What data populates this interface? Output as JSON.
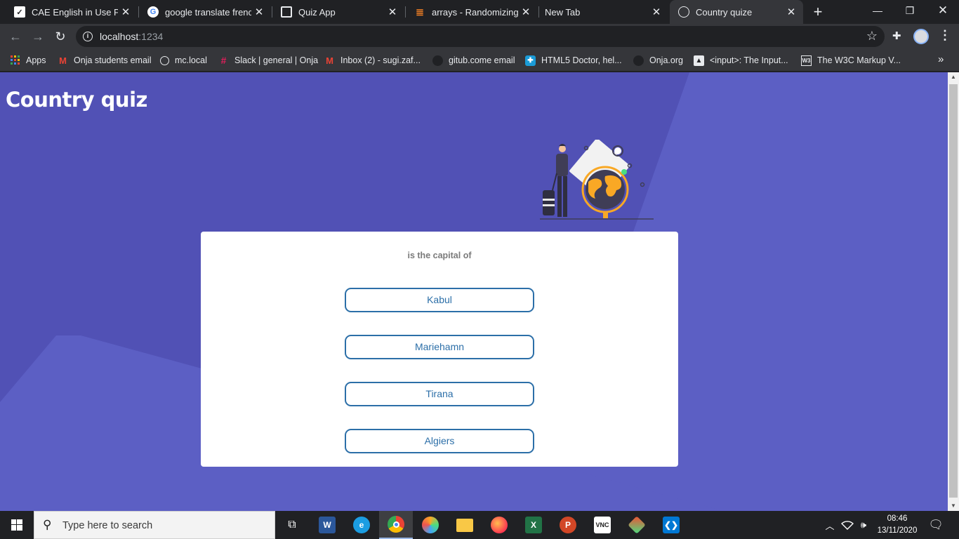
{
  "browser": {
    "tabs": [
      {
        "title": "CAE English in Use Part",
        "icon": "checkbox-icon"
      },
      {
        "title": "google translate french",
        "icon": "google-icon"
      },
      {
        "title": "Quiz App",
        "icon": "codesandbox-icon"
      },
      {
        "title": "arrays - Randomizing q",
        "icon": "stackoverflow-icon"
      },
      {
        "title": "New Tab",
        "icon": ""
      },
      {
        "title": "Country quize",
        "icon": "globe-icon"
      }
    ],
    "address": {
      "host": "localhost",
      "port": ":1234"
    },
    "bookmarks": [
      {
        "label": "Apps"
      },
      {
        "label": "Onja students email"
      },
      {
        "label": "mc.local"
      },
      {
        "label": "Slack | general | Onja"
      },
      {
        "label": "Inbox (2) - sugi.zaf..."
      },
      {
        "label": "gitub.come email"
      },
      {
        "label": "HTML5 Doctor, hel..."
      },
      {
        "label": "Onja.org"
      },
      {
        "label": "<input>: The Input..."
      },
      {
        "label": "The W3C Markup V..."
      }
    ]
  },
  "page": {
    "title": "Country quiz",
    "question": "is the capital of",
    "answers": [
      "Kabul",
      "Mariehamn",
      "Tirana",
      "Algiers"
    ]
  },
  "taskbar": {
    "search_placeholder": "Type here to search",
    "time": "08:46",
    "date": "13/11/2020"
  },
  "colors": {
    "page_bg": "#5c5fc4",
    "accent": "#2c6fa8",
    "title": "#ffffff"
  }
}
